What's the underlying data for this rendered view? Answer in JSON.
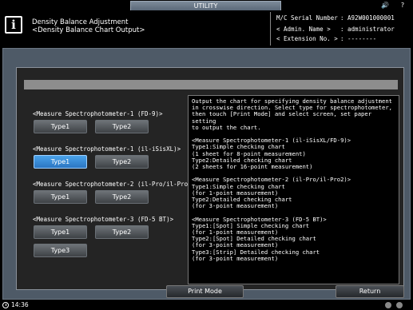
{
  "topbar": {
    "tab_label": "UTILITY",
    "speaker_icon": "speaker-icon",
    "help_icon": "help-icon",
    "help_glyph": "?"
  },
  "header": {
    "title_line1": "Density Balance Adjustment",
    "title_line2": "<Density Balance Chart Output>",
    "serial_label": "M/C Serial Number",
    "serial_value": ": A92W001000001",
    "admin_label": "< Admin. Name >",
    "admin_value": ": administrator",
    "ext_label": "< Extension No. >",
    "ext_value": ": --------"
  },
  "sections": [
    {
      "label": "<Measure Spectrophotometer-1 (FD-9)>",
      "buttons": [
        "Type1",
        "Type2"
      ],
      "selected": -1
    },
    {
      "label": "<Measure Spectrophotometer-1 (il-iSisXL)>",
      "buttons": [
        "Type1",
        "Type2"
      ],
      "selected": 0
    },
    {
      "label": "<Measure Spectrophotometer-2 (il-Pro/il-Pro2)>",
      "buttons": [
        "Type1",
        "Type2"
      ],
      "selected": -1
    },
    {
      "label": "<Measure Spectrophotometer-3 (FD-5 BT)>",
      "buttons": [
        "Type1",
        "Type2",
        "Type3"
      ],
      "selected": -1
    }
  ],
  "description": "Output the chart for specifying density balance adjustment\nin crosswise direction. Select type for spectrophotometer,\nthen touch [Print Mode] and select screen, set paper setting\nto output the chart.\n\n<Measure Spectrophotometer-1 (il-iSisXL/FD-9)>\nType1:Simple checking chart\n(1 sheet for 8-point measurement)\nType2:Detailed checking chart\n(2 sheets for 16-point measurement)\n\n<Measure Spectrophotometer-2 (il-Pro/il-Pro2)>\nType1:Simple checking chart\n(for 1-point measurement)\nType2:Detailed checking chart\n(for 3-point measurement)\n\n<Measure Spectrophotometer-3 (FD-5 BT)>\nType1:[Spot] Simple checking chart\n(for 1-point measurement)\nType2:[Spot] Detailed checking chart\n(for 3-point measurement)\nType3:[Strip] Detailed checking chart\n(for 3-point measurement)",
  "footer": {
    "print_mode_label": "Print Mode",
    "return_label": "Return"
  },
  "status": {
    "time": "14:36",
    "clock_icon": "clock-icon"
  },
  "colors": {
    "selected_button": "#3b8fdc",
    "frame_bg": "#4e5a67",
    "panel_bg": "#242424"
  }
}
